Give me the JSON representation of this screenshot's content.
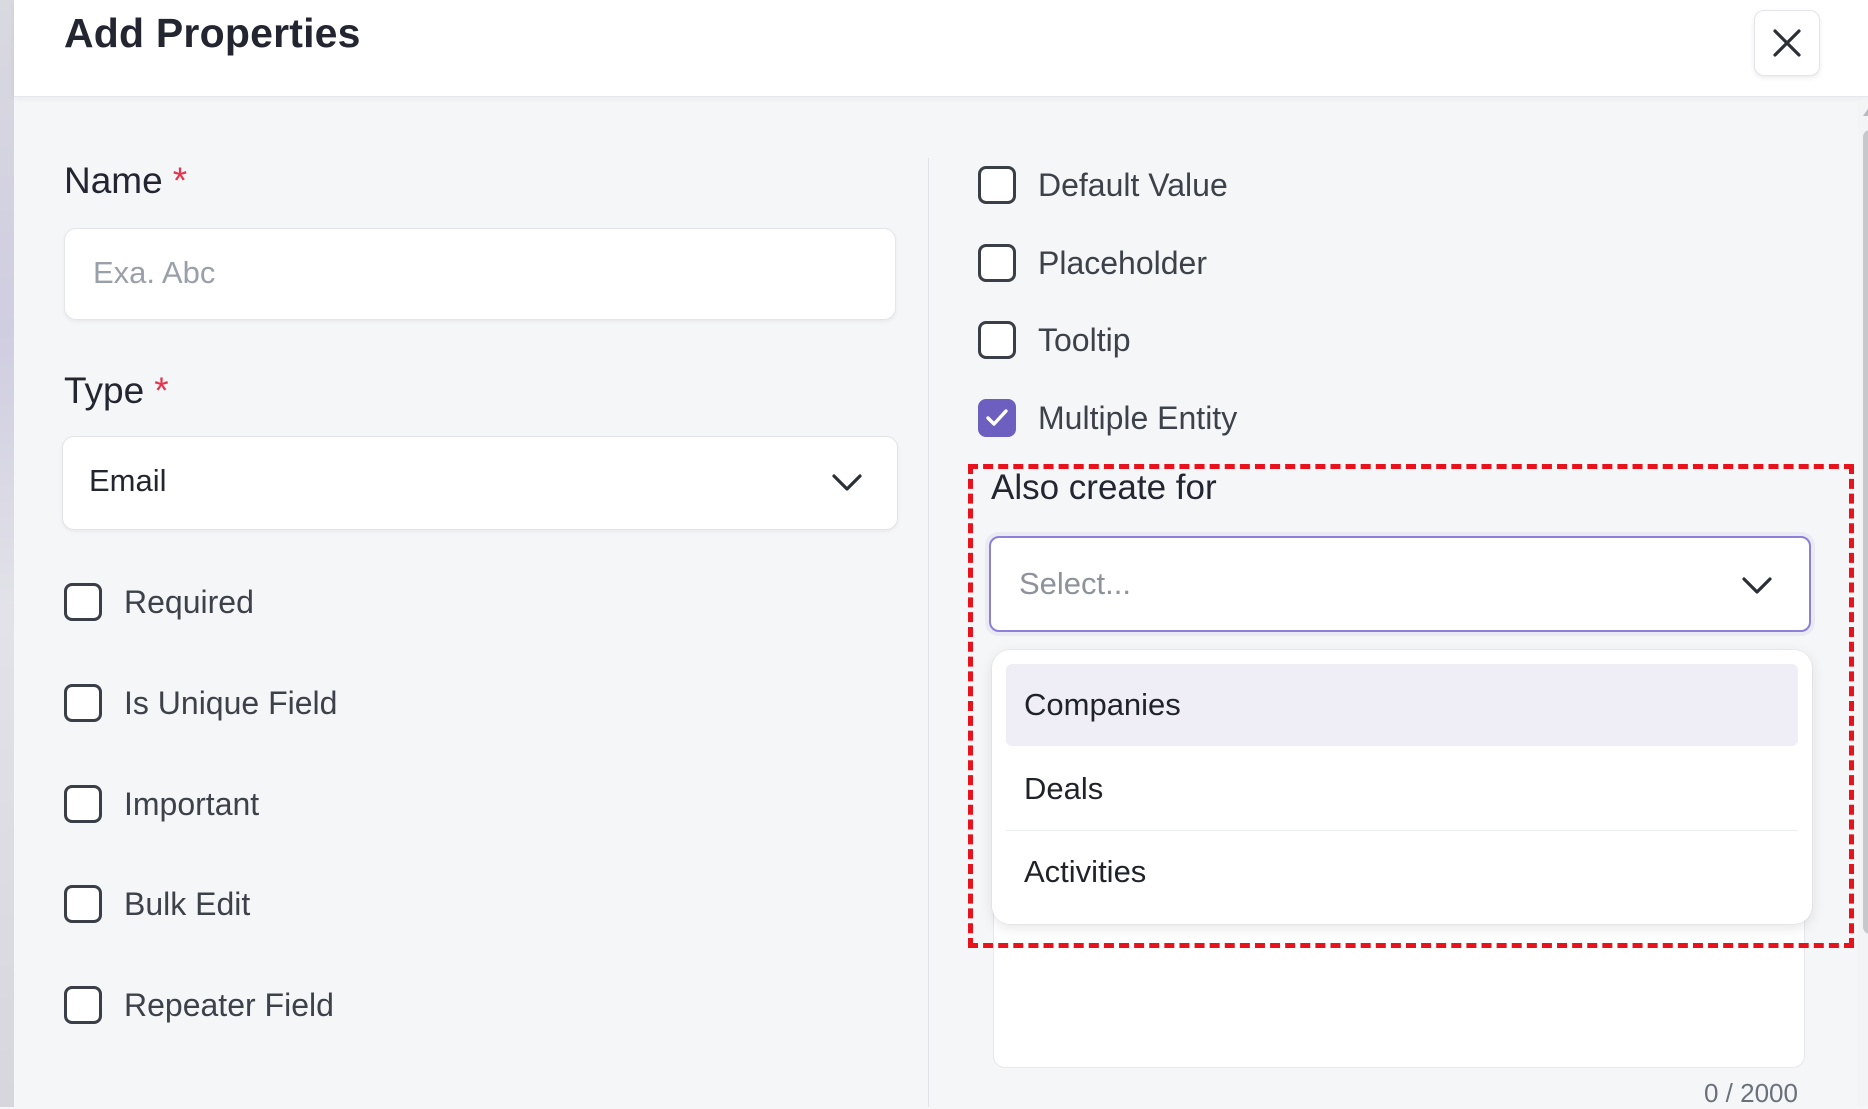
{
  "dialog": {
    "title": "Add Properties",
    "close_icon": "close-icon"
  },
  "left": {
    "name_label": "Name",
    "name_required": "*",
    "name_placeholder": "Exa. Abc",
    "type_label": "Type",
    "type_required": "*",
    "type_value": "Email",
    "checkboxes": [
      {
        "label": "Required",
        "checked": false
      },
      {
        "label": "Is Unique Field",
        "checked": false
      },
      {
        "label": "Important",
        "checked": false
      },
      {
        "label": "Bulk Edit",
        "checked": false
      },
      {
        "label": "Repeater Field",
        "checked": false
      }
    ]
  },
  "right": {
    "checkboxes": [
      {
        "label": "Default Value",
        "checked": false
      },
      {
        "label": "Placeholder",
        "checked": false
      },
      {
        "label": "Tooltip",
        "checked": false
      },
      {
        "label": "Multiple Entity",
        "checked": true
      }
    ],
    "also_create_label": "Also create for",
    "select_placeholder": "Select...",
    "options": [
      "Companies",
      "Deals",
      "Activities"
    ],
    "highlighted_option": "Companies",
    "char_counter": "0 / 2000"
  },
  "colors": {
    "accent": "#6c5fbf",
    "required": "#e5344b",
    "highlight_border": "#e8121c"
  }
}
